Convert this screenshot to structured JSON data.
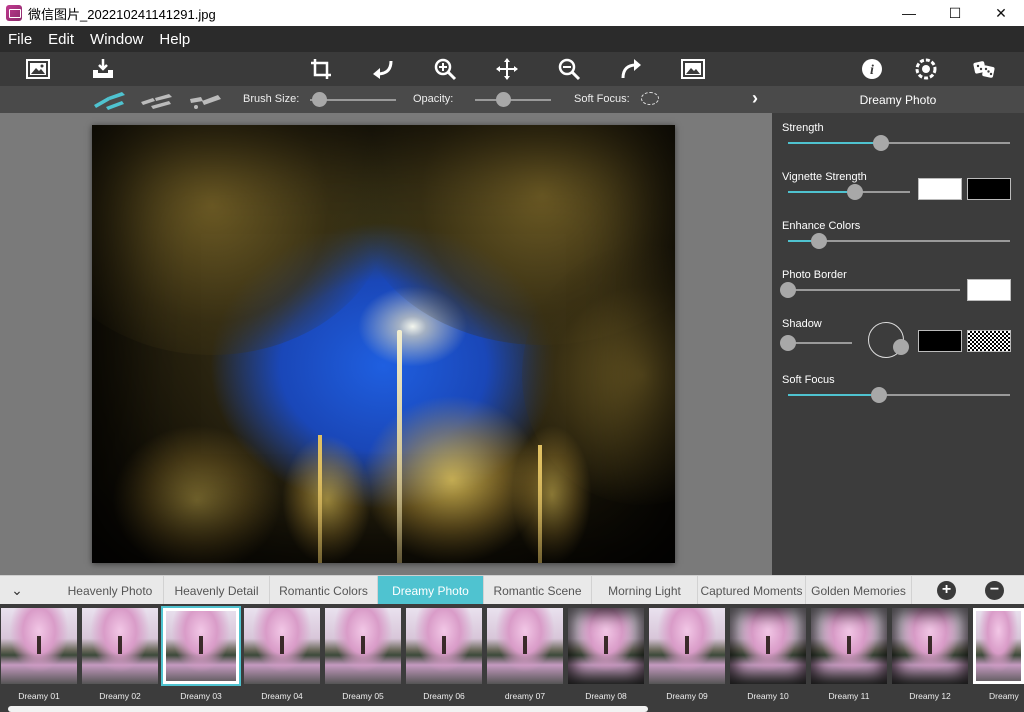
{
  "window": {
    "title": "微信图片_202210241141291.jpg",
    "minimize_glyph": "—",
    "maximize_glyph": "☐",
    "close_glyph": "✕"
  },
  "menu": {
    "items": [
      "File",
      "Edit",
      "Window",
      "Help"
    ]
  },
  "toolbar": {
    "icons": [
      "open-image-icon",
      "save-icon",
      "crop-icon",
      "undo-icon",
      "zoom-in-icon",
      "move-icon",
      "zoom-out-icon",
      "redo-icon",
      "fit-image-icon",
      "info-icon",
      "settings-icon",
      "random-icon"
    ]
  },
  "brushbar": {
    "brush_size_label": "Brush Size:",
    "brush_size_value": 0.05,
    "opacity_label": "Opacity:",
    "opacity_value": 0.38,
    "soft_focus_label": "Soft Focus:",
    "next_glyph": "›"
  },
  "panel": {
    "title": "Dreamy Photo",
    "accent_color": "#4fc3d0",
    "controls": {
      "strength": {
        "label": "Strength",
        "value": 0.42
      },
      "vignette_strength": {
        "label": "Vignette Strength",
        "value": 0.55
      },
      "enhance_colors": {
        "label": "Enhance Colors",
        "value": 0.14
      },
      "photo_border": {
        "label": "Photo Border",
        "value": 0.0
      },
      "shadow": {
        "label": "Shadow",
        "value": 0.0
      },
      "soft_focus": {
        "label": "Soft Focus",
        "value": 0.41
      }
    }
  },
  "tabs": {
    "collapse_glyph": "⌄",
    "items": [
      "Heavenly Photo",
      "Heavenly Detail",
      "Romantic Colors",
      "Dreamy Photo",
      "Romantic Scene",
      "Morning Light",
      "Captured Moments",
      "Golden Memories"
    ],
    "active": "Dreamy Photo",
    "add_glyph": "+",
    "remove_glyph": "−"
  },
  "presets": {
    "items": [
      "Dreamy 01",
      "Dreamy 02",
      "Dreamy 03",
      "Dreamy 04",
      "Dreamy 05",
      "Dreamy 06",
      "dreamy 07",
      "Dreamy 08",
      "Dreamy 09",
      "Dreamy 10",
      "Dreamy 11",
      "Dreamy 12",
      "Dreamy"
    ],
    "selected": "Dreamy 03"
  }
}
